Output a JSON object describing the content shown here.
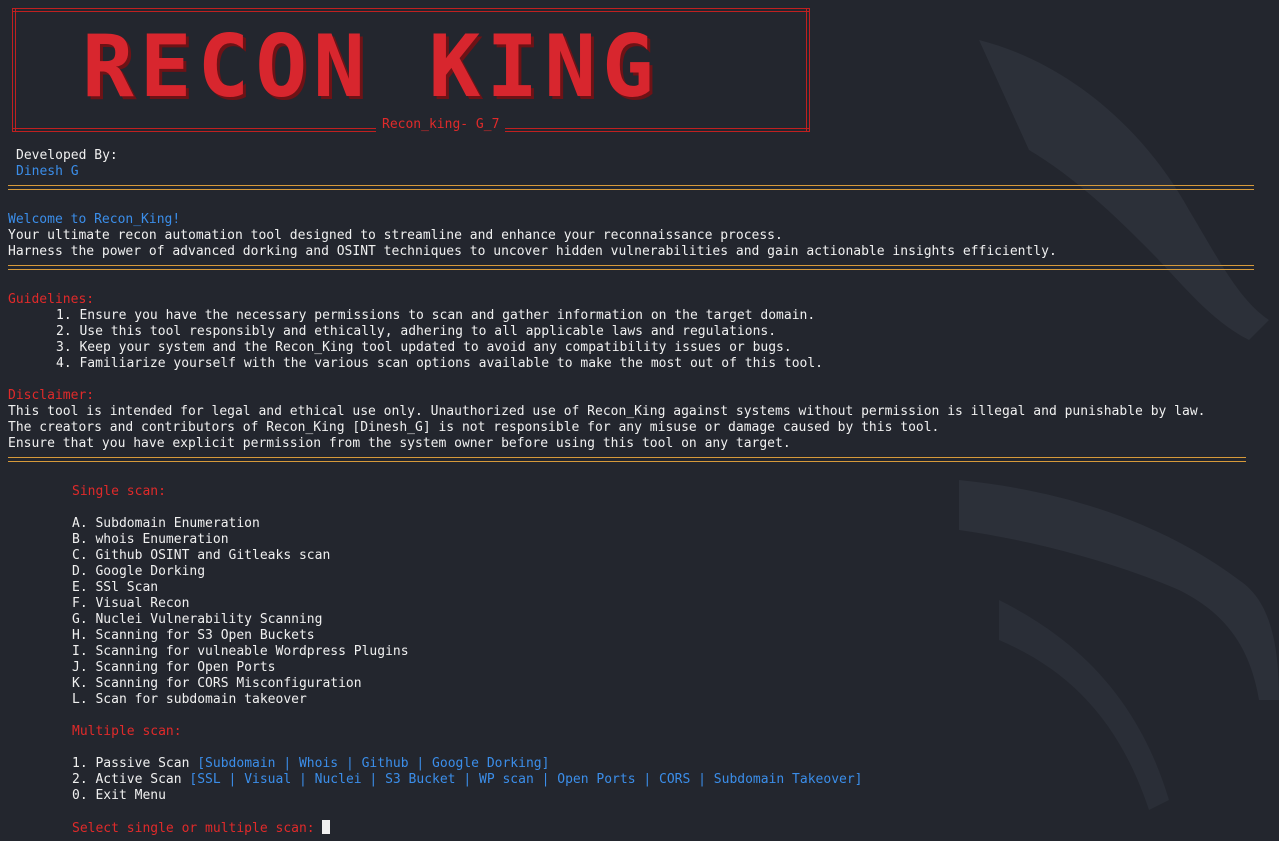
{
  "banner": {
    "title": "RECON KING",
    "subtitle": "Recon_king- G_7"
  },
  "developer": {
    "label": "Developed By:",
    "name": "Dinesh G"
  },
  "welcome": {
    "heading": "Welcome to Recon_King!",
    "line1": "Your ultimate recon automation tool designed to streamline and enhance your reconnaissance process.",
    "line2": "Harness the power of advanced dorking and OSINT techniques to uncover hidden vulnerabilities and gain actionable insights efficiently."
  },
  "guidelines": {
    "heading": "Guidelines:",
    "items": [
      "1. Ensure you have the necessary permissions to scan and gather information on the target domain.",
      "2. Use this tool responsibly and ethically, adhering to all applicable laws and regulations.",
      "3. Keep your system and the Recon_King tool updated to avoid any compatibility issues or bugs.",
      "4. Familiarize yourself with the various scan options available to make the most out of this tool."
    ]
  },
  "disclaimer": {
    "heading": "Disclaimer:",
    "line1": "This tool is intended for legal and ethical use only. Unauthorized use of Recon_King against systems without permission is illegal and punishable by law.",
    "line2": "The creators and contributors of Recon_King [Dinesh_G] is not responsible for any misuse or damage caused by this tool.",
    "line3": "Ensure that you have explicit permission from the system owner before using this tool on any target."
  },
  "single_scan": {
    "heading": "Single scan:",
    "options": [
      "A. Subdomain Enumeration",
      "B. whois Enumeration",
      "C. Github OSINT and Gitleaks scan",
      "D. Google Dorking",
      "E. SSl Scan",
      "F. Visual Recon",
      "G. Nuclei Vulnerability Scanning",
      "H. Scanning for S3 Open Buckets",
      "I. Scanning for vulneable Wordpress Plugins",
      "J. Scanning for Open Ports",
      "K. Scanning for CORS Misconfiguration",
      "L. Scan for subdomain takeover"
    ]
  },
  "multiple_scan": {
    "heading": "Multiple scan:",
    "passive_label": "1. Passive Scan ",
    "passive_detail": "[Subdomain | Whois | Github | Google Dorking]",
    "active_label": "2. Active Scan ",
    "active_detail": "[SSL | Visual | Nuclei | S3 Bucket | WP scan | Open Ports | CORS | Subdomain Takeover]",
    "exit_label": "0. Exit Menu"
  },
  "prompt": {
    "text": "Select single or multiple scan: "
  },
  "colors": {
    "background": "#23262e",
    "accent_red": "#e02a2a",
    "accent_blue": "#3b8eea",
    "separator": "#d79a3a"
  }
}
